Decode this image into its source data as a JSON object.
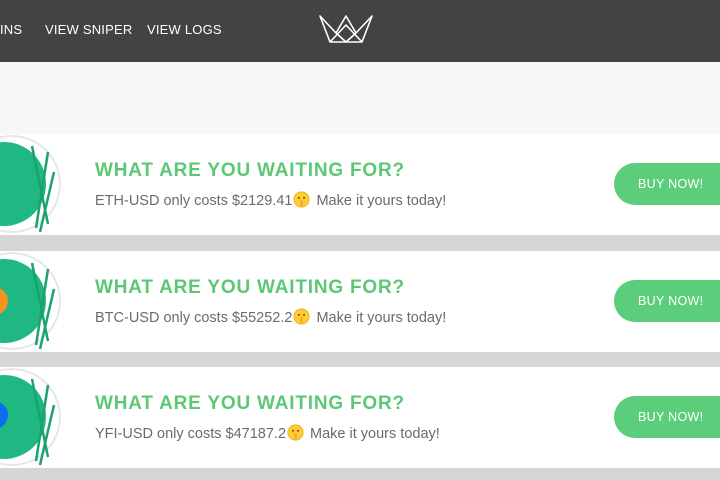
{
  "nav": {
    "items": [
      {
        "label": "INS"
      },
      {
        "label": "VIEW SNIPER"
      },
      {
        "label": "VIEW LOGS"
      }
    ],
    "logo_icon": "crown-logo-icon"
  },
  "colors": {
    "topbar": "#434343",
    "accent_green": "#5cc775",
    "button_green": "#5ccd7a",
    "band_gray": "#d6d6d6"
  },
  "cards": [
    {
      "coin": "ETH",
      "coin_color": "#1fb882",
      "headline": "WHAT ARE YOU WAITING FOR?",
      "text_before": "ETH-USD only costs $2129.41",
      "text_after": " Make it yours today!",
      "emoji_icon": "shushing-face-emoji-icon",
      "button_label": "BUY NOW!"
    },
    {
      "coin": "BTC",
      "coin_color": "#f7931a",
      "headline": "WHAT ARE YOU WAITING FOR?",
      "text_before": "BTC-USD only costs $55252.2",
      "text_after": " Make it yours today!",
      "emoji_icon": "shushing-face-emoji-icon",
      "button_label": "BUY NOW!"
    },
    {
      "coin": "YFI",
      "coin_color": "#0b6ef0",
      "headline": "WHAT ARE YOU WAITING FOR?",
      "text_before": "YFI-USD only costs $47187.2",
      "text_after": " Make it yours today!",
      "emoji_icon": "shushing-face-emoji-icon",
      "button_label": "BUY NOW!"
    }
  ]
}
